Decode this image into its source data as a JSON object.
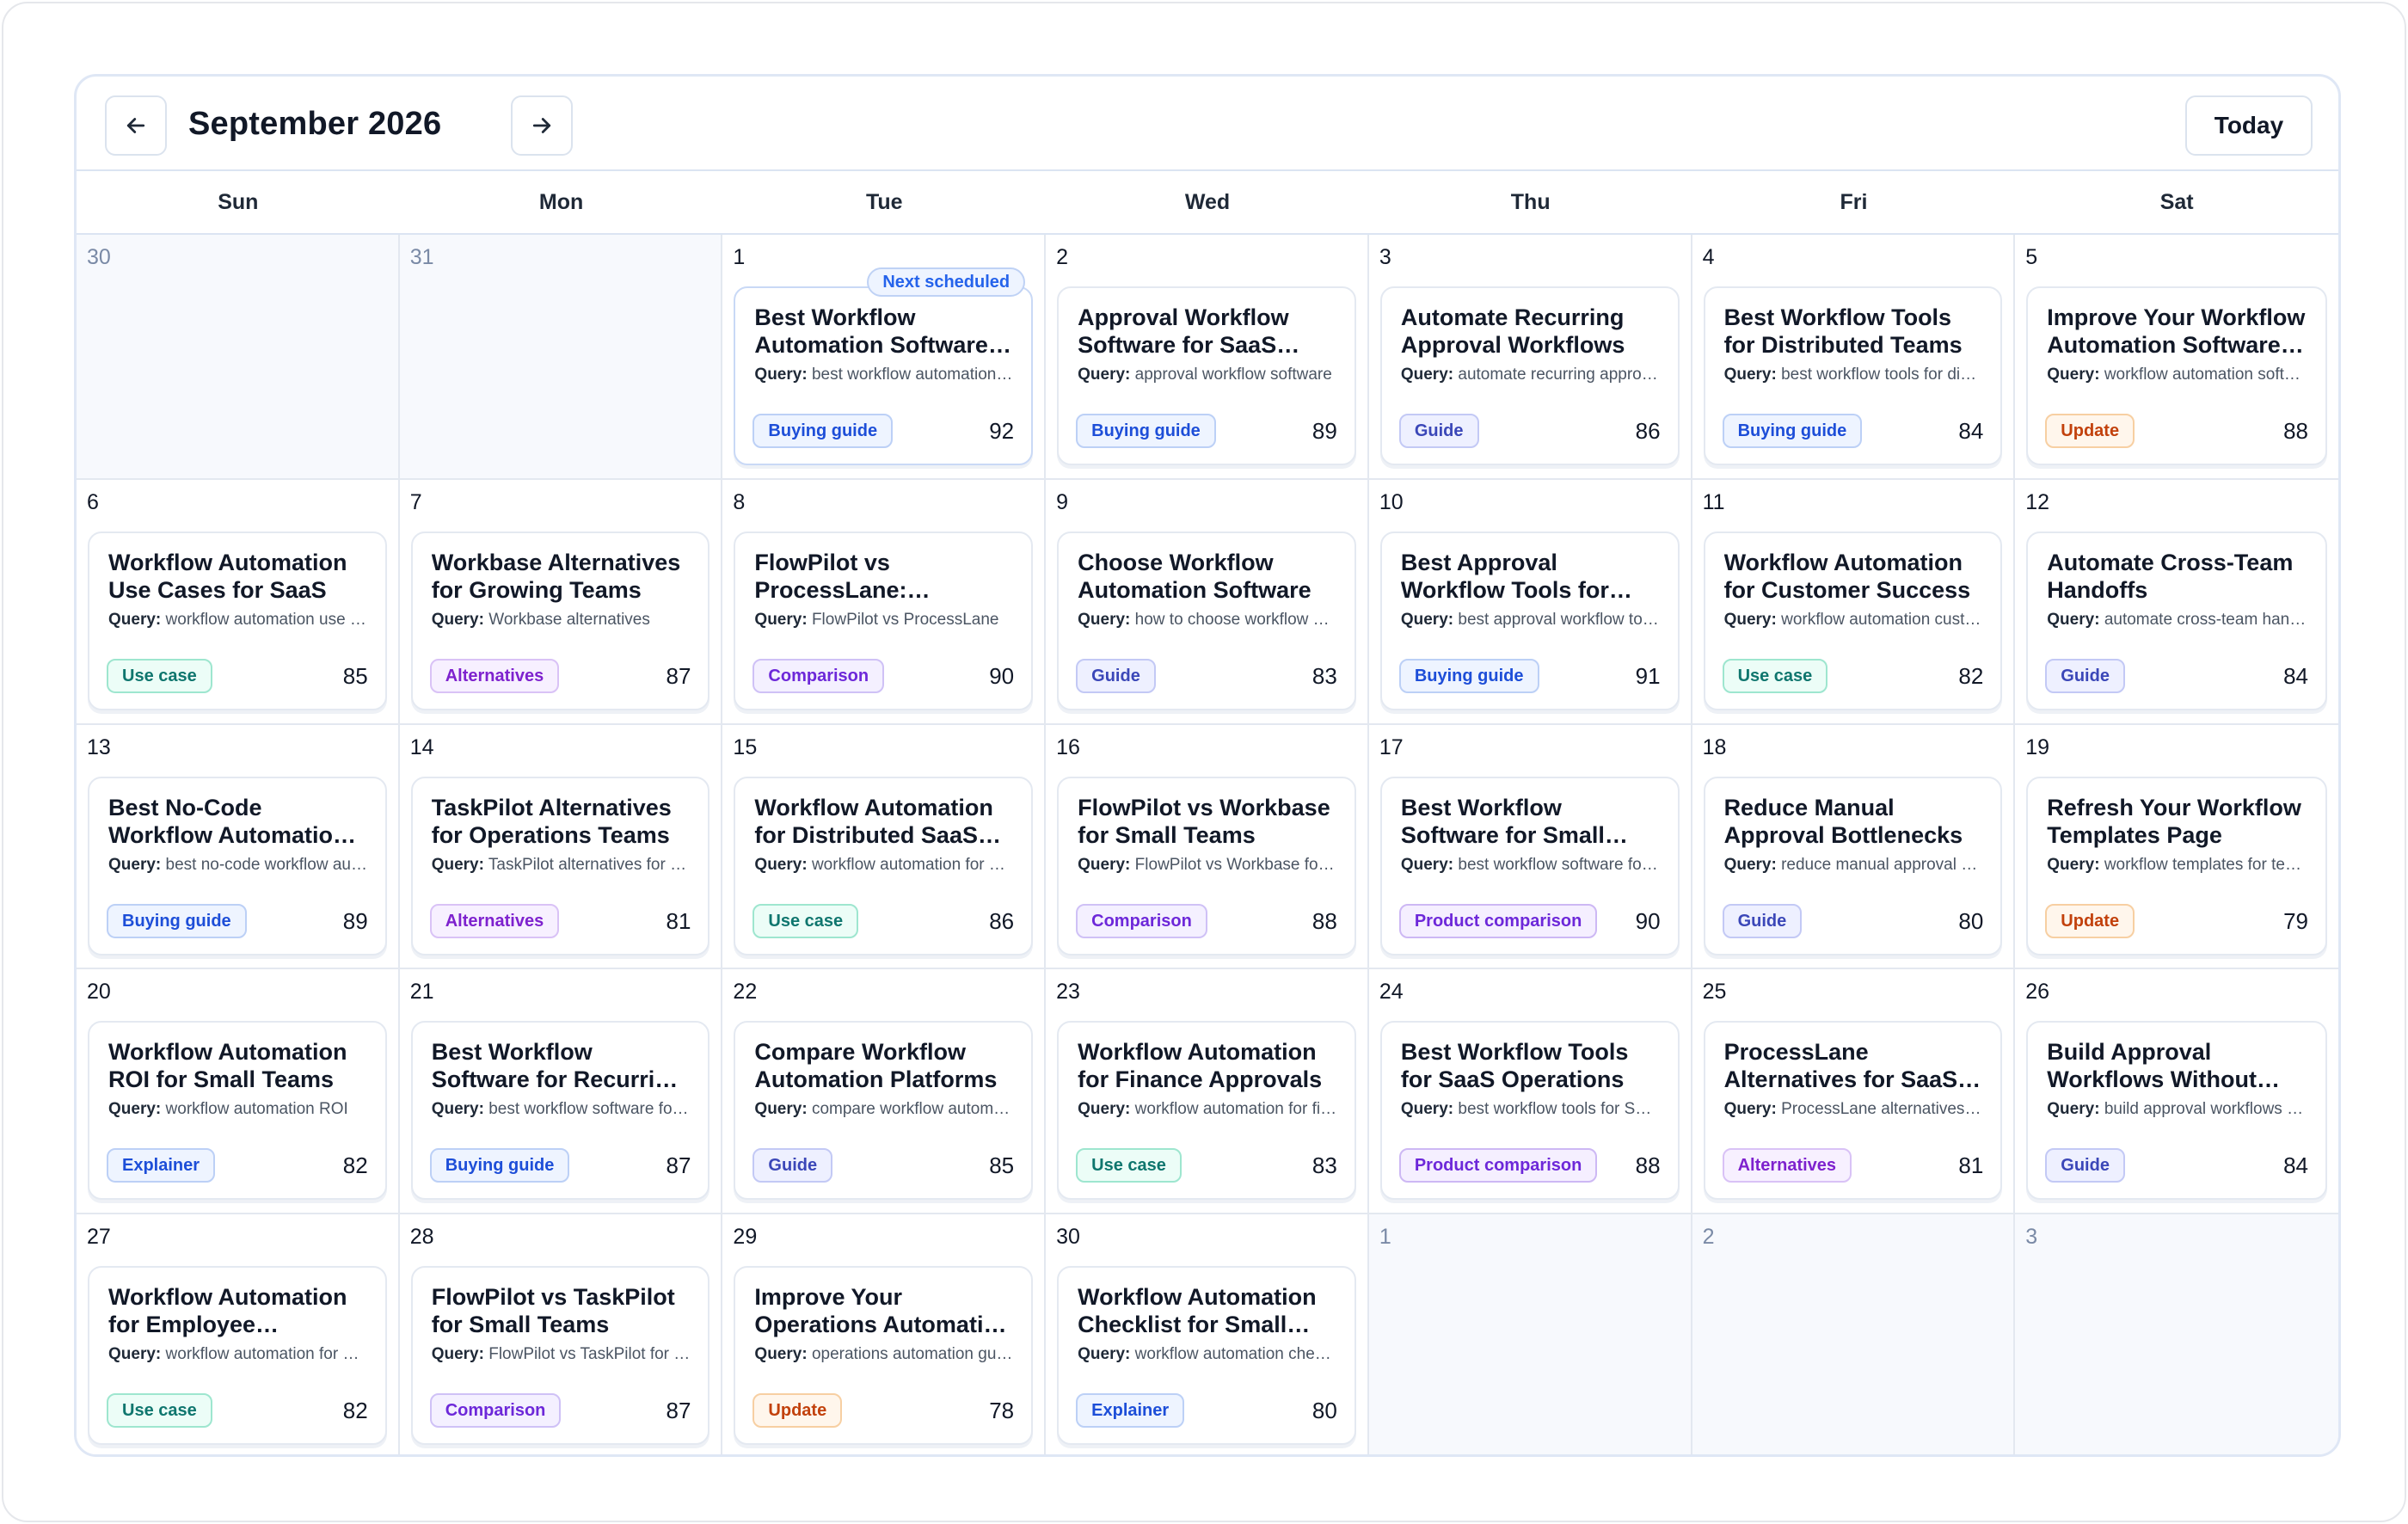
{
  "header": {
    "month_title": "September 2026",
    "today_label": "Today",
    "prev_icon": "arrow-left-icon",
    "next_icon": "arrow-right-icon"
  },
  "weekdays": [
    "Sun",
    "Mon",
    "Tue",
    "Wed",
    "Thu",
    "Fri",
    "Sat"
  ],
  "query_label": "Query:",
  "next_badge_label": "Next scheduled",
  "tag_colors": {
    "Buying guide": "#1d4ed8",
    "Guide": "#3b47b8",
    "Update": "#c2410c",
    "Use case": "#0f766e",
    "Alternatives": "#7e22ce",
    "Comparison": "#6d28d9",
    "Product comparison": "#6d28d9",
    "Explainer": "#1d4ed8"
  },
  "days": [
    {
      "day": "30",
      "outside": true
    },
    {
      "day": "31",
      "outside": true
    },
    {
      "day": "1",
      "next": true,
      "title": "Best Workflow Automation Software for SaaS Teams",
      "query": "best workflow automation software",
      "tag": "Buying guide",
      "score": "92"
    },
    {
      "day": "2",
      "title": "Approval Workflow Software for SaaS Companies",
      "query": "approval workflow software",
      "tag": "Buying guide",
      "score": "89"
    },
    {
      "day": "3",
      "title": "Automate Recurring Approval Workflows",
      "query": "automate recurring approval workflows",
      "tag": "Guide",
      "score": "86"
    },
    {
      "day": "4",
      "title": "Best Workflow Tools for Distributed Teams",
      "query": "best workflow tools for distributed teams",
      "tag": "Buying guide",
      "score": "84"
    },
    {
      "day": "5",
      "title": "Improve Your Workflow Automation Software Page",
      "query": "workflow automation software",
      "tag": "Update",
      "score": "88"
    },
    {
      "day": "6",
      "title": "Workflow Automation Use Cases for SaaS",
      "query": "workflow automation use cases",
      "tag": "Use case",
      "score": "85"
    },
    {
      "day": "7",
      "title": "Workbase Alternatives for Growing Teams",
      "query": "Workbase alternatives",
      "tag": "Alternatives",
      "score": "87"
    },
    {
      "day": "8",
      "title": "FlowPilot vs ProcessLane: Workflow Comparison",
      "query": "FlowPilot vs ProcessLane",
      "tag": "Comparison",
      "score": "90"
    },
    {
      "day": "9",
      "title": "Choose Workflow Automation Software",
      "query": "how to choose workflow automation software",
      "tag": "Guide",
      "score": "83"
    },
    {
      "day": "10",
      "title": "Best Approval Workflow Tools for Small Business",
      "query": "best approval workflow tools",
      "tag": "Buying guide",
      "score": "91"
    },
    {
      "day": "11",
      "title": "Workflow Automation for Customer Success",
      "query": "workflow automation customer success",
      "tag": "Use case",
      "score": "82"
    },
    {
      "day": "12",
      "title": "Automate Cross-Team Handoffs",
      "query": "automate cross-team handoffs",
      "tag": "Guide",
      "score": "84"
    },
    {
      "day": "13",
      "title": "Best No-Code Workflow Automation Tools",
      "query": "best no-code workflow automation tools",
      "tag": "Buying guide",
      "score": "89"
    },
    {
      "day": "14",
      "title": "TaskPilot Alternatives for Operations Teams",
      "query": "TaskPilot alternatives for operations",
      "tag": "Alternatives",
      "score": "81"
    },
    {
      "day": "15",
      "title": "Workflow Automation for Distributed SaaS Teams",
      "query": "workflow automation for distributed teams",
      "tag": "Use case",
      "score": "86"
    },
    {
      "day": "16",
      "title": "FlowPilot vs Workbase for Small Teams",
      "query": "FlowPilot vs Workbase for small teams",
      "tag": "Comparison",
      "score": "88"
    },
    {
      "day": "17",
      "title": "Best Workflow Software for Small Businesses",
      "query": "best workflow software for small business",
      "tag": "Product comparison",
      "score": "90"
    },
    {
      "day": "18",
      "title": "Reduce Manual Approval Bottlenecks",
      "query": "reduce manual approval bottlenecks",
      "tag": "Guide",
      "score": "80"
    },
    {
      "day": "19",
      "title": "Refresh Your Workflow Templates Page",
      "query": "workflow templates for teams",
      "tag": "Update",
      "score": "79"
    },
    {
      "day": "20",
      "title": "Workflow Automation ROI for Small Teams",
      "query": "workflow automation ROI",
      "tag": "Explainer",
      "score": "82"
    },
    {
      "day": "21",
      "title": "Best Workflow Software for Recurring Tasks",
      "query": "best workflow software for recurring tasks",
      "tag": "Buying guide",
      "score": "87"
    },
    {
      "day": "22",
      "title": "Compare Workflow Automation Platforms",
      "query": "compare workflow automation platforms",
      "tag": "Guide",
      "score": "85"
    },
    {
      "day": "23",
      "title": "Workflow Automation for Finance Approvals",
      "query": "workflow automation for finance approvals",
      "tag": "Use case",
      "score": "83"
    },
    {
      "day": "24",
      "title": "Best Workflow Tools for SaaS Operations",
      "query": "best workflow tools for SaaS operations",
      "tag": "Product comparison",
      "score": "88"
    },
    {
      "day": "25",
      "title": "ProcessLane Alternatives for SaaS Teams",
      "query": "ProcessLane alternatives for SaaS",
      "tag": "Alternatives",
      "score": "81"
    },
    {
      "day": "26",
      "title": "Build Approval Workflows Without Code",
      "query": "build approval workflows without code",
      "tag": "Guide",
      "score": "84"
    },
    {
      "day": "27",
      "title": "Workflow Automation for Employee Onboarding",
      "query": "workflow automation for employee onboarding",
      "tag": "Use case",
      "score": "82"
    },
    {
      "day": "28",
      "title": "FlowPilot vs TaskPilot for Small Teams",
      "query": "FlowPilot vs TaskPilot for small teams",
      "tag": "Comparison",
      "score": "87"
    },
    {
      "day": "29",
      "title": "Improve Your Operations Automation Guide",
      "query": "operations automation guide",
      "tag": "Update",
      "score": "78"
    },
    {
      "day": "30",
      "title": "Workflow Automation Checklist for Small Teams",
      "query": "workflow automation checklist",
      "tag": "Explainer",
      "score": "80"
    },
    {
      "day": "1",
      "outside": true
    },
    {
      "day": "2",
      "outside": true
    },
    {
      "day": "3",
      "outside": true
    }
  ]
}
